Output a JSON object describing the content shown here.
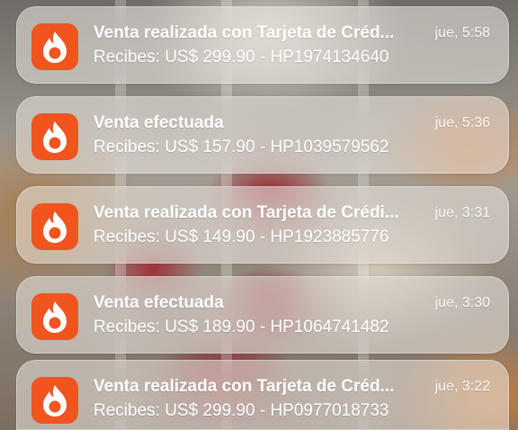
{
  "accent_color": "#f1541f",
  "notifications": [
    {
      "icon": "flame-icon",
      "title": "Venta realizada con Tarjeta de Créd...",
      "body": "Recibes: US$ 299.90 - HP1974134640",
      "time": "jue, 5:58"
    },
    {
      "icon": "flame-icon",
      "title": "Venta efectuada",
      "body": "Recibes: US$ 157.90 - HP1039579562",
      "time": "jue, 5:36"
    },
    {
      "icon": "flame-icon",
      "title": "Venta realizada con Tarjeta de Crédi...",
      "body": "Recibes: US$ 149.90 - HP1923885776",
      "time": "jue, 3:31"
    },
    {
      "icon": "flame-icon",
      "title": "Venta efectuada",
      "body": "Recibes: US$ 189.90 - HP1064741482",
      "time": "jue, 3:30"
    },
    {
      "icon": "flame-icon",
      "title": "Venta realizada con Tarjeta de Créd...",
      "body": "Recibes: US$ 299.90 - HP0977018733",
      "time": "jue, 3:22"
    }
  ]
}
